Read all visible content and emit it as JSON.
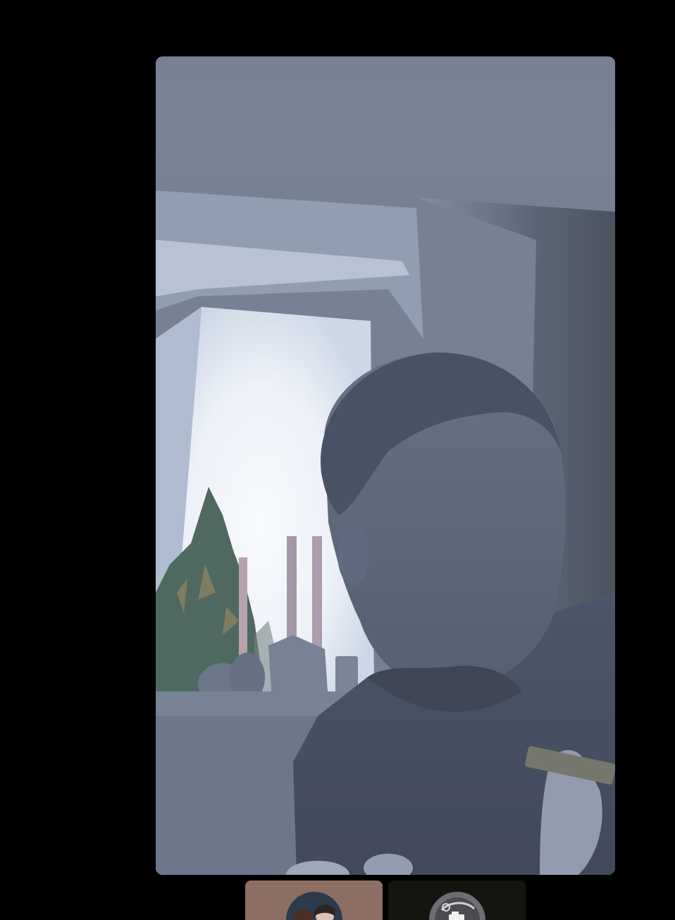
{
  "call": {
    "main_participant": {
      "name": "",
      "video": "live-video-feed"
    },
    "participants": [
      {
        "name": "",
        "icon": "avatar-photo"
      },
      {
        "name": "",
        "icon": "avatar-photo"
      }
    ]
  },
  "colors": {
    "background": "#000000",
    "tile_1": "#8c6e63",
    "tile_2": "#15140f"
  }
}
